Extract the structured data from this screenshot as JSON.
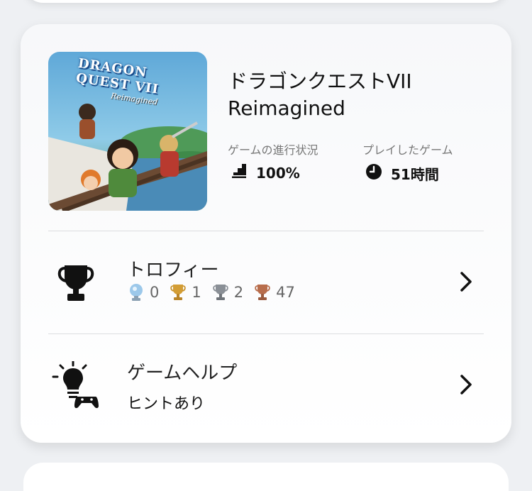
{
  "game": {
    "title_line1": "ドラゴンクエストVII",
    "title_line2": "Reimagined",
    "cover_logo": "DRAGON QUEST VII",
    "cover_subtitle": "Reimagined",
    "progress_label": "ゲームの進行状況",
    "progress_value": "100%",
    "playtime_label": "プレイしたゲーム",
    "playtime_value": "51時間"
  },
  "trophies": {
    "title": "トロフィー",
    "platinum": "0",
    "gold": "1",
    "silver": "2",
    "bronze": "47"
  },
  "help": {
    "title": "ゲームヘルプ",
    "subtitle": "ヒントあり"
  },
  "colors": {
    "platinum": "#7fb2dc",
    "gold": "#c9932e",
    "silver": "#8a8f96",
    "bronze": "#b86d4c"
  },
  "icons": [
    "progress-stairs-icon",
    "clock-icon",
    "trophy-icon",
    "lightbulb-controller-icon",
    "chevron-right-icon"
  ]
}
